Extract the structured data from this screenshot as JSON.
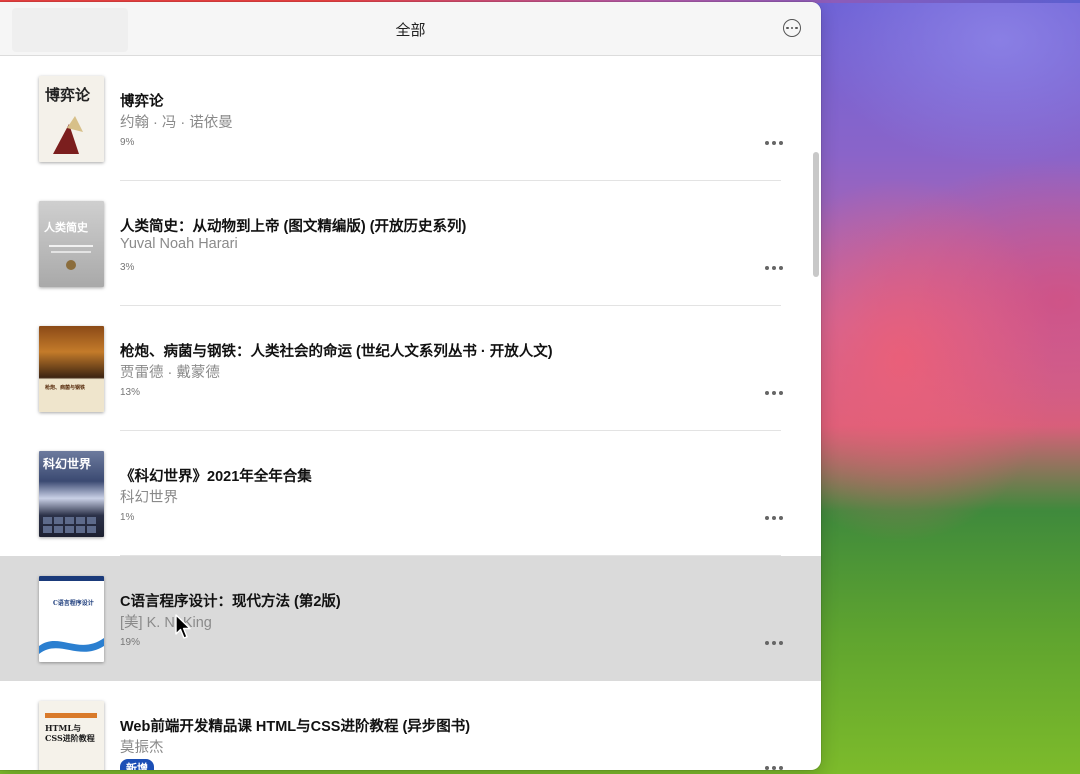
{
  "window": {
    "title": "全部"
  },
  "books": [
    {
      "title": "博弈论",
      "author": "约翰 · 冯 · 诺依曼",
      "progress": "9%",
      "cover_text": "博弈论"
    },
    {
      "title": "人类简史：从动物到上帝 (图文精编版) (开放历史系列)",
      "author": "Yuval Noah Harari",
      "progress": "3%",
      "cover_text": "人类简史"
    },
    {
      "title": "枪炮、病菌与钢铁：人类社会的命运 (世纪人文系列丛书 · 开放人文)",
      "author": "贾雷德 · 戴蒙德",
      "progress": "13%",
      "cover_text": "枪炮、病菌与钢铁"
    },
    {
      "title": "《科幻世界》2021年全年合集",
      "author": "科幻世界",
      "progress": "1%",
      "cover_text": "科幻世界"
    },
    {
      "title": "C语言程序设计：现代方法 (第2版)",
      "author": "[美] K. N. King",
      "progress": "19%",
      "cover_text": "C语言程序设计"
    },
    {
      "title": "Web前端开发精品课 HTML与CSS进阶教程 (异步图书)",
      "author": "莫振杰",
      "badge": "新增",
      "cover_text": "HTML与CSS进阶教程"
    }
  ],
  "colors": {
    "accent": "#1c4fb6",
    "selected_row": "#dadada"
  }
}
